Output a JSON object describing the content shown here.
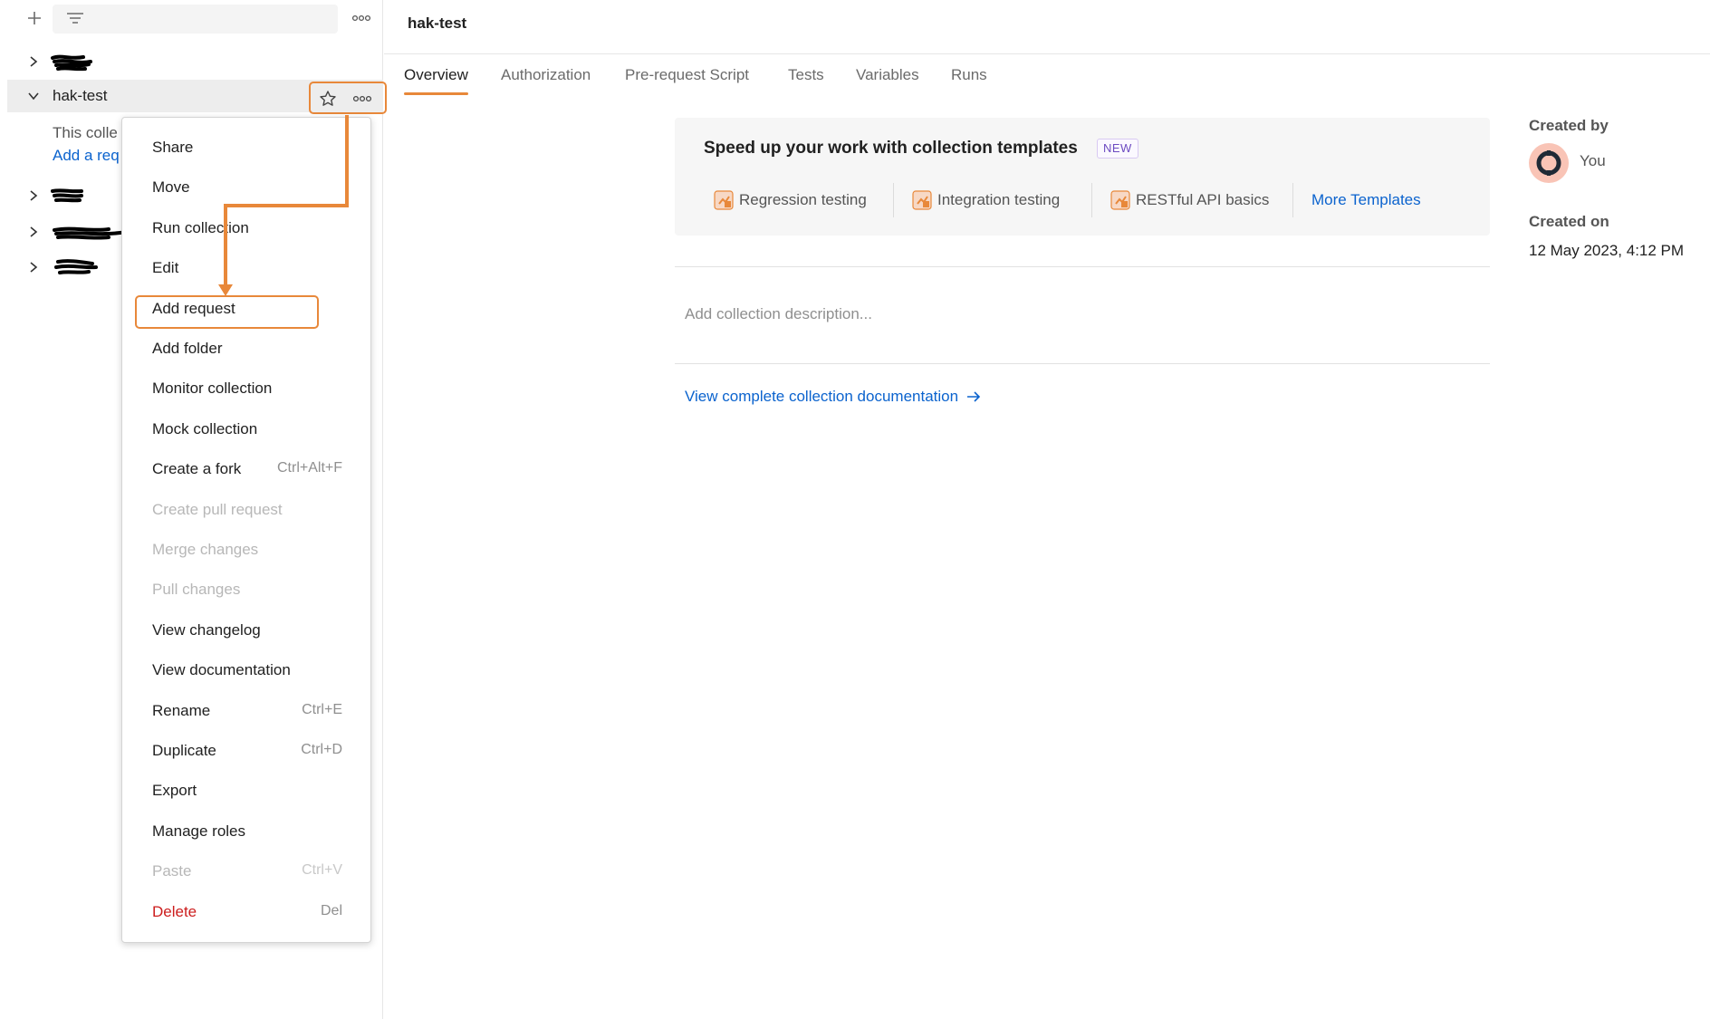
{
  "colors": {
    "accent": "#e8883a",
    "link": "#0b63ce",
    "danger": "#cc1d1d",
    "badge": "#6c4bc1"
  },
  "sidebar": {
    "icons": {
      "add": "plus-icon",
      "filter": "filter-icon",
      "more": "more-horizontal-icon"
    },
    "collections": [
      {
        "label": "",
        "redacted": true,
        "expanded": false
      },
      {
        "label": "hak-test",
        "redacted": false,
        "expanded": true,
        "selected": true
      },
      {
        "label": "",
        "redacted": true,
        "expanded": false
      },
      {
        "label": "",
        "redacted": true,
        "expanded": false
      },
      {
        "label": "",
        "redacted": true,
        "expanded": false
      }
    ],
    "empty_state": {
      "text": "This colle",
      "link": "Add a req"
    }
  },
  "context_menu": {
    "items": [
      {
        "label": "Share",
        "shortcut": "",
        "state": "normal"
      },
      {
        "label": "Move",
        "shortcut": "",
        "state": "normal"
      },
      {
        "label": "Run collection",
        "shortcut": "",
        "state": "normal"
      },
      {
        "label": "Edit",
        "shortcut": "",
        "state": "normal"
      },
      {
        "label": "Add request",
        "shortcut": "",
        "state": "highlighted"
      },
      {
        "label": "Add folder",
        "shortcut": "",
        "state": "normal"
      },
      {
        "label": "Monitor collection",
        "shortcut": "",
        "state": "normal"
      },
      {
        "label": "Mock collection",
        "shortcut": "",
        "state": "normal"
      },
      {
        "label": "Create a fork",
        "shortcut": "Ctrl+Alt+F",
        "state": "normal"
      },
      {
        "label": "Create pull request",
        "shortcut": "",
        "state": "disabled"
      },
      {
        "label": "Merge changes",
        "shortcut": "",
        "state": "disabled"
      },
      {
        "label": "Pull changes",
        "shortcut": "",
        "state": "disabled"
      },
      {
        "label": "View changelog",
        "shortcut": "",
        "state": "normal"
      },
      {
        "label": "View documentation",
        "shortcut": "",
        "state": "normal"
      },
      {
        "label": "Rename",
        "shortcut": "Ctrl+E",
        "state": "normal"
      },
      {
        "label": "Duplicate",
        "shortcut": "Ctrl+D",
        "state": "normal"
      },
      {
        "label": "Export",
        "shortcut": "",
        "state": "normal"
      },
      {
        "label": "Manage roles",
        "shortcut": "",
        "state": "normal"
      },
      {
        "label": "Paste",
        "shortcut": "Ctrl+V",
        "state": "disabled"
      },
      {
        "label": "Delete",
        "shortcut": "Del",
        "state": "danger"
      }
    ]
  },
  "main": {
    "title": "hak-test",
    "tabs": [
      {
        "label": "Overview",
        "active": true
      },
      {
        "label": "Authorization",
        "active": false
      },
      {
        "label": "Pre-request Script",
        "active": false
      },
      {
        "label": "Tests",
        "active": false
      },
      {
        "label": "Variables",
        "active": false
      },
      {
        "label": "Runs",
        "active": false
      }
    ],
    "templates": {
      "title": "Speed up your work with collection templates",
      "badge": "NEW",
      "items": [
        {
          "label": "Regression testing",
          "icon": "template-icon"
        },
        {
          "label": "Integration testing",
          "icon": "template-icon"
        },
        {
          "label": "RESTful API basics",
          "icon": "template-icon"
        }
      ],
      "more_link": "More Templates"
    },
    "description_placeholder": "Add collection description...",
    "documentation_link": "View complete collection documentation",
    "meta": {
      "created_by_label": "Created by",
      "created_by_value": "You",
      "created_on_label": "Created on",
      "created_on_value": "12 May 2023, 4:12 PM"
    }
  }
}
